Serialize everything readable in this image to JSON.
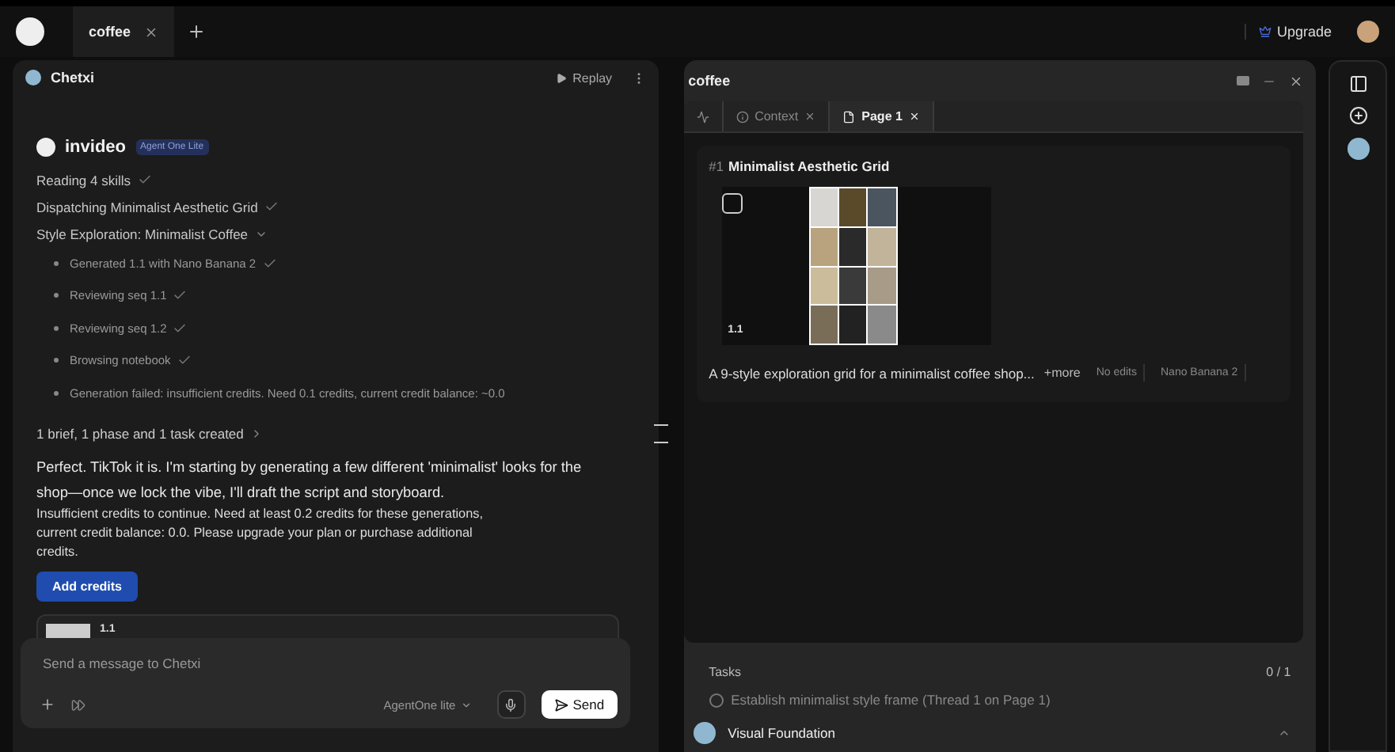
{
  "top_bar": {
    "tabs": [
      {
        "label": "coffee",
        "selected": true
      }
    ],
    "upgrade": "Upgrade"
  },
  "chat": {
    "title": "Chetxi",
    "replay": "Replay",
    "brand": "invideo",
    "badge": "Agent One Lite",
    "steps": [
      {
        "text": "Reading 4 skills",
        "kind": "done"
      },
      {
        "text": "Dispatching Minimalist Aesthetic Grid",
        "kind": "done"
      },
      {
        "text": "Style Exploration: Minimalist Coffee",
        "kind": "group",
        "expanded": true,
        "children": [
          {
            "text": "Generated 1.1 with Nano Banana 2",
            "kind": "done"
          },
          {
            "text": "Reviewing seq 1.1",
            "kind": "done"
          },
          {
            "text": "Reviewing seq 1.2",
            "kind": "done"
          },
          {
            "text": "Browsing notebook",
            "kind": "done"
          },
          {
            "text": "Generation failed: insufficient credits. Need 0.1 credits, current credit balance: ~0.0",
            "kind": "plain"
          }
        ]
      }
    ],
    "summary": "1 brief, 1 phase and 1 task created",
    "message": "Perfect. TikTok it is. I'm starting by generating a few different 'minimalist' looks for the shop—once we lock the vibe, I'll draft the script and storyboard.",
    "error": "Insufficient credits to continue. Need at least 0.2 credits for these generations, current credit balance: 0.0. Please upgrade your plan or purchase additional credits.",
    "add_credits": "Add credits",
    "attachment": {
      "label": "1.1"
    },
    "composer": {
      "placeholder": "Send a message to Chetxi",
      "model": "AgentOne lite",
      "send": "Send"
    }
  },
  "canvas": {
    "title": "coffee",
    "tabs": [
      {
        "label": "Context",
        "kind": "context",
        "selected": false
      },
      {
        "label": "Page 1",
        "kind": "page",
        "selected": true
      }
    ],
    "card": {
      "number": "#1",
      "title": "Minimalist Aesthetic Grid",
      "checked": false,
      "label": "1.1",
      "description": "A 9-style exploration grid for a minimalist coffee shop...",
      "more": "+more",
      "tags": [
        "No edits",
        "Nano Banana 2"
      ]
    },
    "tasks": {
      "title": "Tasks",
      "count": "0 / 1",
      "items": [
        {
          "text": "Establish minimalist style frame (Thread 1 on Page 1)",
          "done": false
        }
      ]
    },
    "phase": {
      "title": "Visual Foundation",
      "expanded": true
    }
  }
}
